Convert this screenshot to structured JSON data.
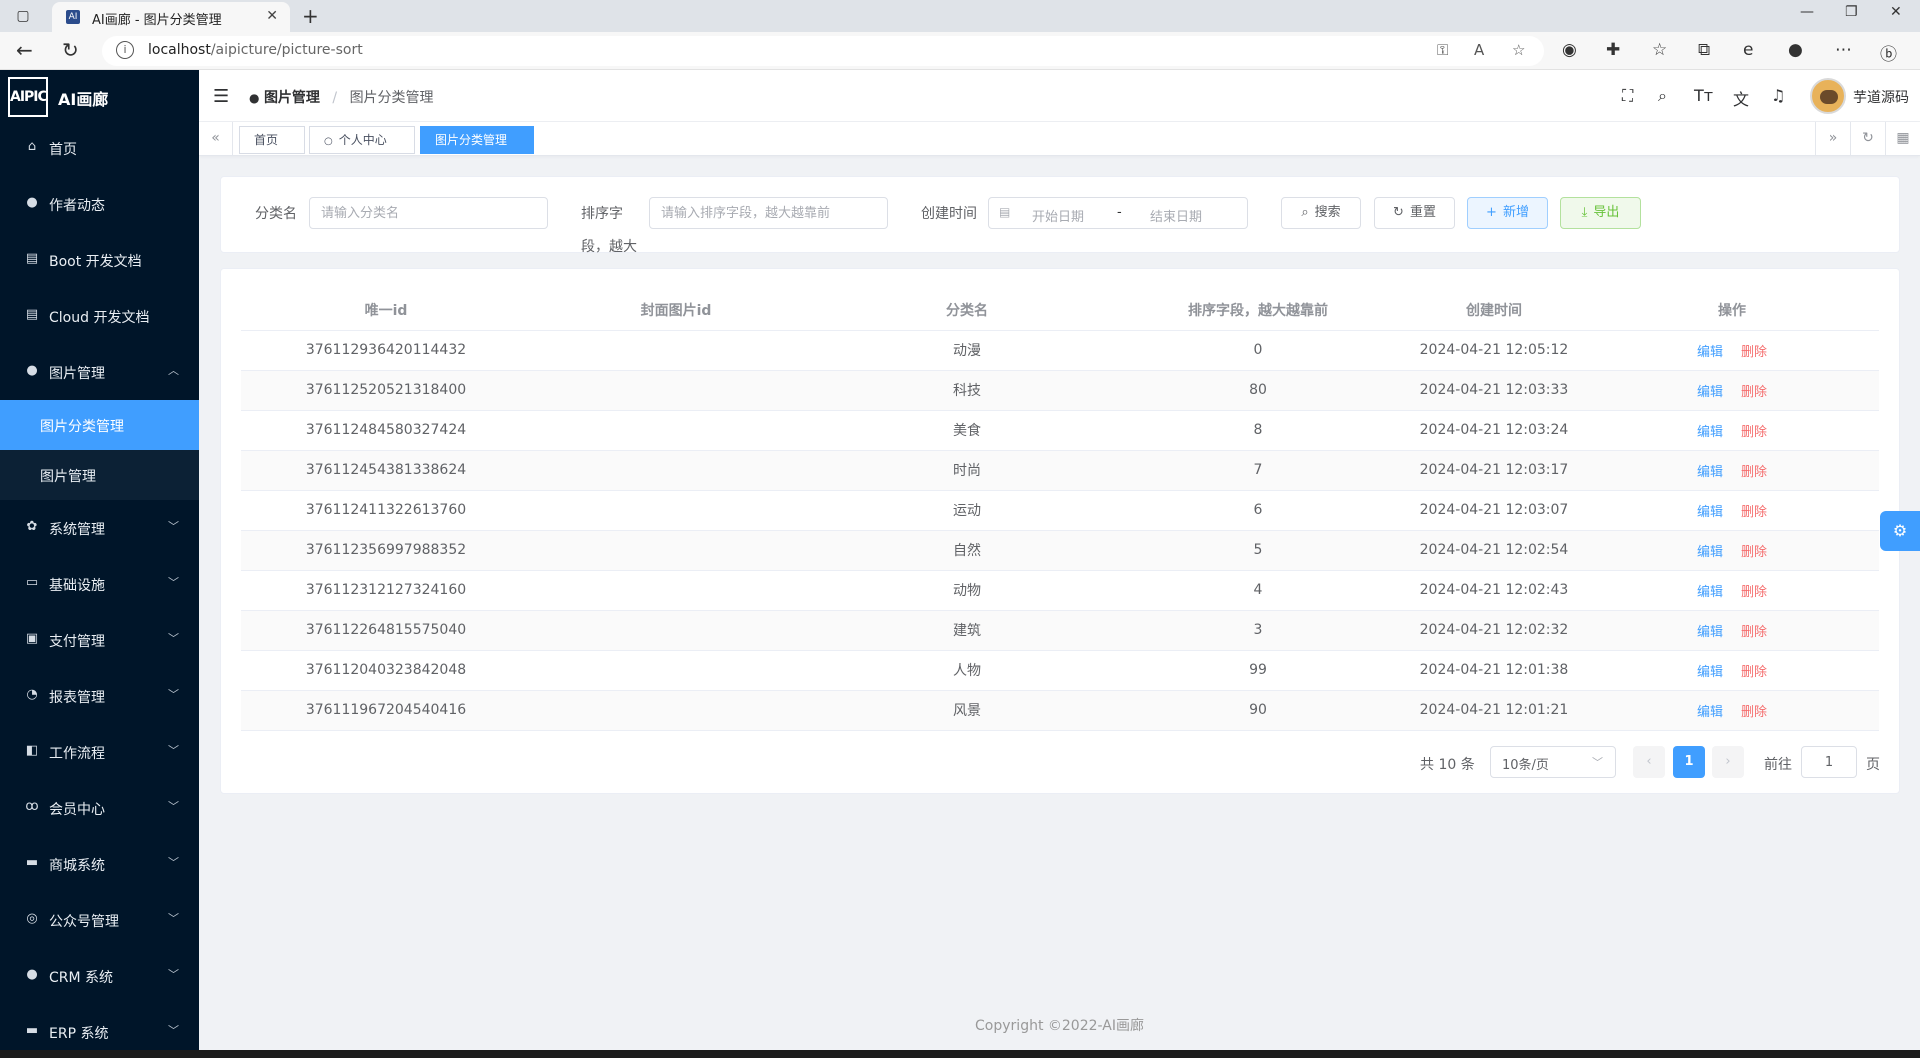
{
  "browser": {
    "tab_title": "AI画廊 - 图片分类管理",
    "favicon_text": "AI",
    "url_host": "localhost",
    "url_path": "/aipicture/picture-sort"
  },
  "app": {
    "logo_text": "AIPIC",
    "title": "AI画廊"
  },
  "sidebar": {
    "items": [
      {
        "label": "首页",
        "icon": "home-icon"
      },
      {
        "label": "作者动态",
        "icon": "user-icon"
      },
      {
        "label": "Boot 开发文档",
        "icon": "document-icon"
      },
      {
        "label": "Cloud 开发文档",
        "icon": "document-icon"
      },
      {
        "label": "图片管理",
        "icon": "user-icon",
        "expanded": true
      },
      {
        "label": "系统管理",
        "icon": "gear-icon"
      },
      {
        "label": "基础设施",
        "icon": "monitor-icon"
      },
      {
        "label": "支付管理",
        "icon": "payment-icon"
      },
      {
        "label": "报表管理",
        "icon": "pie-chart-icon"
      },
      {
        "label": "工作流程",
        "icon": "workflow-icon"
      },
      {
        "label": "会员中心",
        "icon": "bike-icon"
      },
      {
        "label": "商城系统",
        "icon": "store-icon"
      },
      {
        "label": "公众号管理",
        "icon": "compass-icon"
      },
      {
        "label": "CRM 系统",
        "icon": "user-icon"
      },
      {
        "label": "ERP 系统",
        "icon": "truck-icon"
      }
    ],
    "submenu": [
      {
        "label": "图片分类管理",
        "active": true
      },
      {
        "label": "图片管理",
        "active": false
      }
    ]
  },
  "header": {
    "breadcrumb_1": "图片管理",
    "breadcrumb_2": "图片分类管理",
    "username": "芋道源码"
  },
  "tags": [
    {
      "label": "首页",
      "active": false
    },
    {
      "label": "个人中心",
      "active": false
    },
    {
      "label": "图片分类管理",
      "active": true
    }
  ],
  "search": {
    "name_label": "分类名",
    "name_placeholder": "请输入分类名",
    "sort_label_line1": "排序字",
    "sort_label_line2": "段，越大",
    "sort_placeholder": "请输入排序字段，越大越靠前",
    "time_label": "创建时间",
    "start_placeholder": "开始日期",
    "range_separator": "-",
    "end_placeholder": "结束日期",
    "search_btn": "搜索",
    "reset_btn": "重置",
    "add_btn": "新增",
    "export_btn": "导出"
  },
  "table": {
    "headers": [
      "唯一id",
      "封面图片id",
      "分类名",
      "排序字段，越大越靠前",
      "创建时间",
      "操作"
    ],
    "edit_label": "编辑",
    "delete_label": "删除",
    "rows": [
      {
        "id": "376112936420114432",
        "cover": "",
        "name": "动漫",
        "sort": "0",
        "time": "2024-04-21 12:05:12"
      },
      {
        "id": "376112520521318400",
        "cover": "",
        "name": "科技",
        "sort": "80",
        "time": "2024-04-21 12:03:33"
      },
      {
        "id": "376112484580327424",
        "cover": "",
        "name": "美食",
        "sort": "8",
        "time": "2024-04-21 12:03:24"
      },
      {
        "id": "376112454381338624",
        "cover": "",
        "name": "时尚",
        "sort": "7",
        "time": "2024-04-21 12:03:17"
      },
      {
        "id": "376112411322613760",
        "cover": "",
        "name": "运动",
        "sort": "6",
        "time": "2024-04-21 12:03:07"
      },
      {
        "id": "376112356997988352",
        "cover": "",
        "name": "自然",
        "sort": "5",
        "time": "2024-04-21 12:02:54"
      },
      {
        "id": "376112312127324160",
        "cover": "",
        "name": "动物",
        "sort": "4",
        "time": "2024-04-21 12:02:43"
      },
      {
        "id": "376112264815575040",
        "cover": "",
        "name": "建筑",
        "sort": "3",
        "time": "2024-04-21 12:02:32"
      },
      {
        "id": "376112040323842048",
        "cover": "",
        "name": "人物",
        "sort": "99",
        "time": "2024-04-21 12:01:38"
      },
      {
        "id": "376111967204540416",
        "cover": "",
        "name": "风景",
        "sort": "90",
        "time": "2024-04-21 12:01:21"
      }
    ]
  },
  "pagination": {
    "total_text": "共 10 条",
    "page_size": "10条/页",
    "current_page": "1",
    "goto_prefix": "前往",
    "goto_value": "1",
    "goto_suffix": "页"
  },
  "footer": {
    "copyright": "Copyright ©2022-AI画廊"
  },
  "colors": {
    "primary": "#409eff",
    "sidebar_bg": "#001529",
    "danger": "#f56c6c",
    "success": "#67c23a"
  }
}
